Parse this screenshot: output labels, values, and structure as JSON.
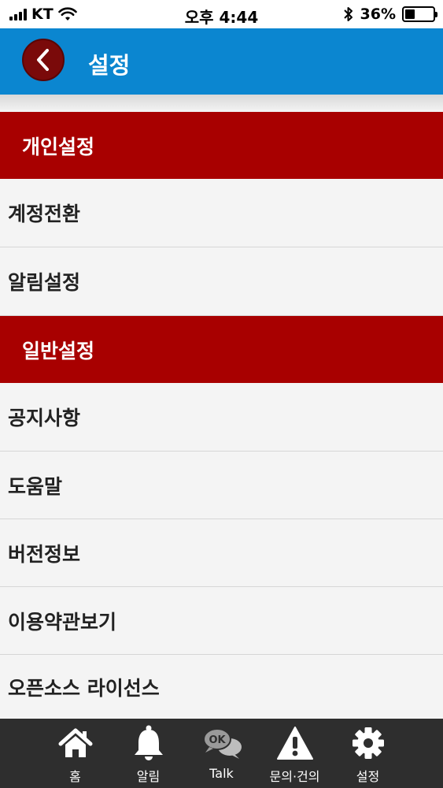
{
  "status_bar": {
    "carrier": "KT",
    "time": "오후 4:44",
    "battery_percent": "36%",
    "battery_level": 0.36
  },
  "header": {
    "title": "설정",
    "back_icon": "chevron-left-icon"
  },
  "sections": [
    {
      "label": "개인설정",
      "items": [
        "계정전환",
        "알림설정"
      ]
    },
    {
      "label": "일반설정",
      "items": [
        "공지사항",
        "도움말",
        "버전정보",
        "이용약관보기",
        "오픈소스 라이선스"
      ]
    }
  ],
  "tabbar": {
    "items": [
      {
        "label": "홈",
        "icon": "home-icon"
      },
      {
        "label": "알림",
        "icon": "bell-icon"
      },
      {
        "label": "Talk",
        "icon": "ok-talk-icon",
        "badge_text": "OK"
      },
      {
        "label": "문의·건의",
        "icon": "warning-icon"
      },
      {
        "label": "설정",
        "icon": "gear-icon"
      }
    ]
  },
  "colors": {
    "header_bg": "#0b86d0",
    "section_bg": "#a80000",
    "back_button_bg": "#7a0a0a",
    "tabbar_bg": "#2e2e2e",
    "list_bg": "#f4f4f4"
  }
}
